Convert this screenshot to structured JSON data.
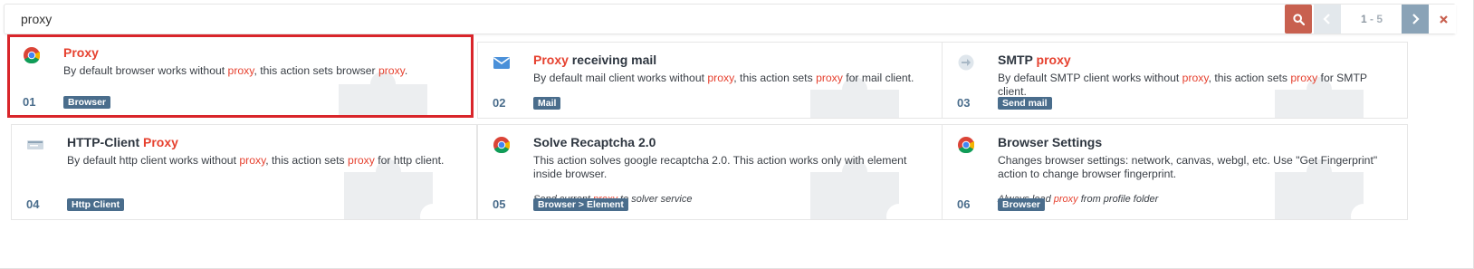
{
  "search": {
    "value": "proxy"
  },
  "pager": {
    "current": "1",
    "separator": " - ",
    "total": "5"
  },
  "colors": {
    "accent": "#e6412f",
    "badge": "#4a6d8c",
    "search_button": "#c8604f",
    "selection": "#d9252a"
  },
  "cards": [
    {
      "number": "01",
      "icon": "chrome-icon",
      "title_parts": [
        {
          "text": "Proxy",
          "hl": true
        }
      ],
      "desc_parts": [
        {
          "text": "By default browser works without ",
          "hl": false
        },
        {
          "text": "proxy",
          "hl": true
        },
        {
          "text": ", this action sets browser ",
          "hl": false
        },
        {
          "text": "proxy",
          "hl": true
        },
        {
          "text": ".",
          "hl": false
        }
      ],
      "note_parts": [],
      "badge": "Browser",
      "selected": true
    },
    {
      "number": "02",
      "icon": "mail-icon",
      "title_parts": [
        {
          "text": "Proxy",
          "hl": true
        },
        {
          "text": " receiving mail",
          "hl": false
        }
      ],
      "desc_parts": [
        {
          "text": "By default mail client works without ",
          "hl": false
        },
        {
          "text": "proxy",
          "hl": true
        },
        {
          "text": ", this action sets ",
          "hl": false
        },
        {
          "text": "proxy",
          "hl": true
        },
        {
          "text": " for mail client.",
          "hl": false
        }
      ],
      "note_parts": [],
      "badge": "Mail",
      "selected": false
    },
    {
      "number": "03",
      "icon": "smtp-icon",
      "title_parts": [
        {
          "text": "SMTP ",
          "hl": false
        },
        {
          "text": "proxy",
          "hl": true
        }
      ],
      "desc_parts": [
        {
          "text": "By default SMTP client works without ",
          "hl": false
        },
        {
          "text": "proxy",
          "hl": true
        },
        {
          "text": ", this action sets ",
          "hl": false
        },
        {
          "text": "proxy",
          "hl": true
        },
        {
          "text": " for SMTP client.",
          "hl": false
        }
      ],
      "note_parts": [],
      "badge": "Send mail",
      "selected": false
    },
    {
      "number": "04",
      "icon": "http-icon",
      "title_parts": [
        {
          "text": "HTTP-Client ",
          "hl": false
        },
        {
          "text": "Proxy",
          "hl": true
        }
      ],
      "desc_parts": [
        {
          "text": "By default http client works without ",
          "hl": false
        },
        {
          "text": "proxy",
          "hl": true
        },
        {
          "text": ", this action sets ",
          "hl": false
        },
        {
          "text": "proxy",
          "hl": true
        },
        {
          "text": " for http client.",
          "hl": false
        }
      ],
      "note_parts": [],
      "badge": "Http Client",
      "selected": false
    },
    {
      "number": "05",
      "icon": "chrome-icon",
      "title_parts": [
        {
          "text": "Solve Recaptcha 2.0",
          "hl": false
        }
      ],
      "desc_parts": [
        {
          "text": "This action solves google recaptcha 2.0. This action works only with element inside browser.",
          "hl": false
        }
      ],
      "note_parts": [
        {
          "text": "Send current ",
          "hl": false
        },
        {
          "text": "proxy",
          "hl": true
        },
        {
          "text": " to solver service",
          "hl": false
        }
      ],
      "badge": "Browser > Element",
      "selected": false
    },
    {
      "number": "06",
      "icon": "chrome-icon",
      "title_parts": [
        {
          "text": "Browser Settings",
          "hl": false
        }
      ],
      "desc_parts": [
        {
          "text": "Changes browser settings: network, canvas, webgl, etc. Use \"Get Fingerprint\" action to change browser fingerprint.",
          "hl": false
        }
      ],
      "note_parts": [
        {
          "text": "Always load ",
          "hl": false
        },
        {
          "text": "proxy",
          "hl": true
        },
        {
          "text": " from profile folder",
          "hl": false
        }
      ],
      "badge": "Browser",
      "selected": false
    }
  ]
}
